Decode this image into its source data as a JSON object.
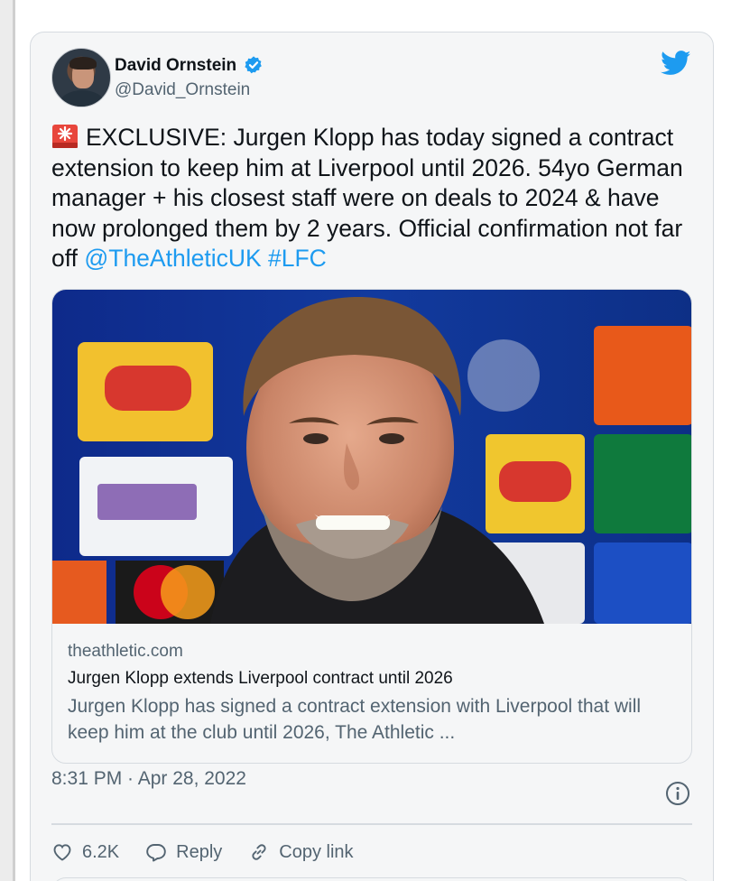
{
  "author": {
    "name": "David Ornstein",
    "handle": "@David_Ornstein",
    "verified": true
  },
  "tweet": {
    "emoji_icon": "siren-icon",
    "text_main": "EXCLUSIVE: Jurgen Klopp has today signed a contract extension to keep him at Liverpool until 2026. 54yo German manager + his closest staff were on deals to 2024 & have now prolonged them by 2 years. Official confirmation not far off ",
    "mention": "@TheAthleticUK",
    "hashtag": "#LFC"
  },
  "link_card": {
    "image_icon": "klopp-press-conference-photo",
    "domain": "theathletic.com",
    "title": "Jurgen Klopp extends Liverpool contract until 2026",
    "description": "Jurgen Klopp has signed a contract extension with Liverpool that will keep him at the club until 2026, The Athletic ..."
  },
  "timestamp": "8:31 PM · Apr 28, 2022",
  "actions": {
    "likes_count": "6.2K",
    "reply_label": "Reply",
    "copy_link_label": "Copy link"
  },
  "colors": {
    "link_blue": "#1d9bf0",
    "secondary_text": "#536471",
    "card_bg": "#f5f6f7",
    "border": "#d6dbe0"
  }
}
